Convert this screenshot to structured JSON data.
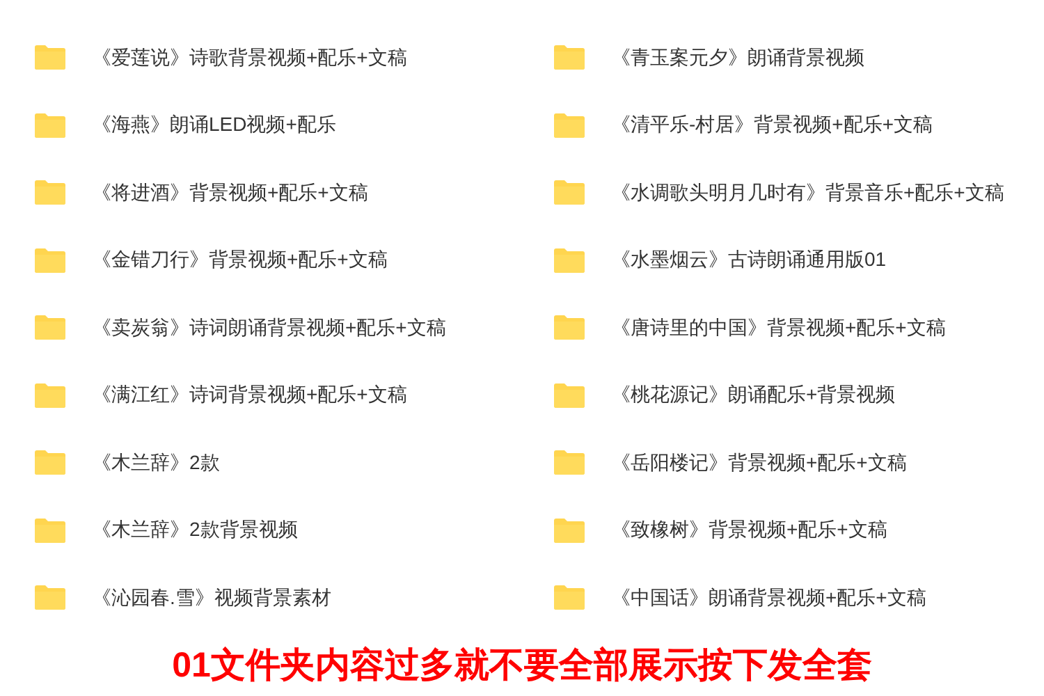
{
  "columns": [
    {
      "folders": [
        "《爱莲说》诗歌背景视频+配乐+文稿",
        "《海燕》朗诵LED视频+配乐",
        "《将进酒》背景视频+配乐+文稿",
        "《金错刀行》背景视频+配乐+文稿",
        "《卖炭翁》诗词朗诵背景视频+配乐+文稿",
        "《满江红》诗词背景视频+配乐+文稿",
        "《木兰辞》2款",
        "《木兰辞》2款背景视频",
        "《沁园春.雪》视频背景素材"
      ]
    },
    {
      "folders": [
        "《青玉案元夕》朗诵背景视频",
        "《清平乐-村居》背景视频+配乐+文稿",
        "《水调歌头明月几时有》背景音乐+配乐+文稿",
        "《水墨烟云》古诗朗诵通用版01",
        "《唐诗里的中国》背景视频+配乐+文稿",
        "《桃花源记》朗诵配乐+背景视频",
        "《岳阳楼记》背景视频+配乐+文稿",
        "《致橡树》背景视频+配乐+文稿",
        "《中国话》朗诵背景视频+配乐+文稿"
      ]
    }
  ],
  "notice": "01文件夹内容过多就不要全部展示按下发全套"
}
